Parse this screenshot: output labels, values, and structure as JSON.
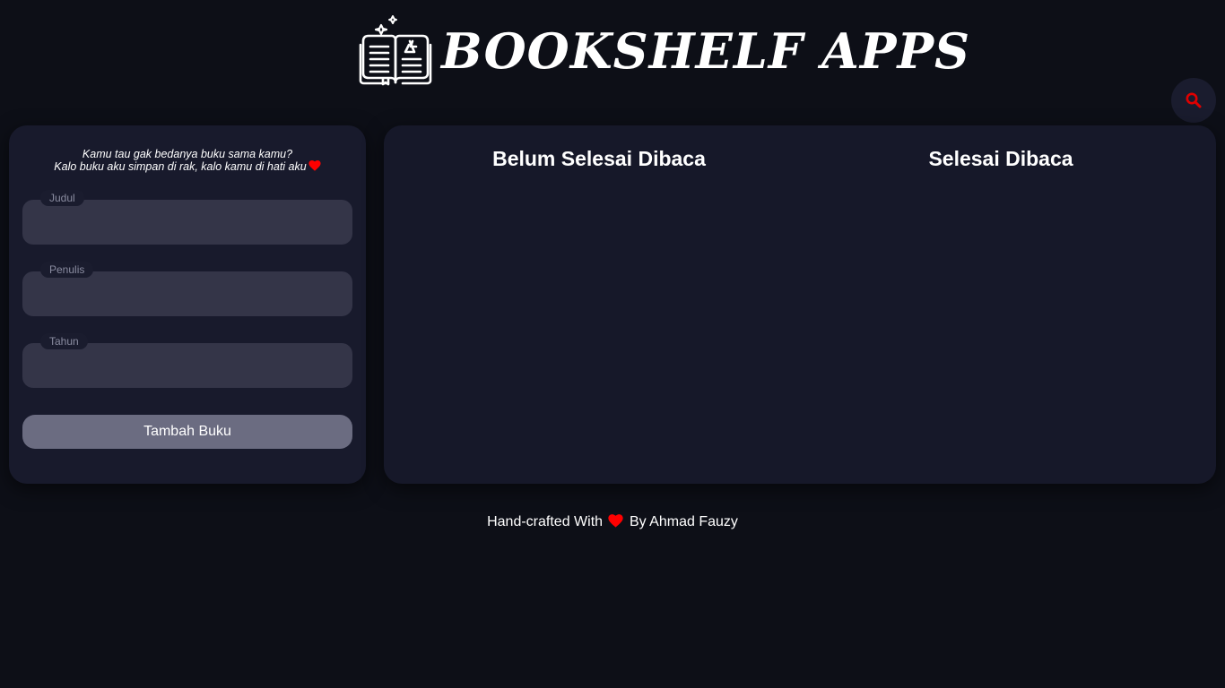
{
  "header": {
    "title": "BOOKSHELF APPS",
    "logo_icon": "open-book-sparkle-icon"
  },
  "search": {
    "icon": "search-icon",
    "icon_color": "#e00000"
  },
  "form": {
    "quote_line1": "Kamu tau gak bedanya buku sama kamu?",
    "quote_line2": "Kalo buku aku simpan di rak, kalo kamu di hati aku",
    "heart_color": "#ff0000",
    "fields": [
      {
        "label": "Judul",
        "value": "",
        "placeholder": ""
      },
      {
        "label": "Penulis",
        "value": "",
        "placeholder": ""
      },
      {
        "label": "Tahun",
        "value": "",
        "placeholder": ""
      }
    ],
    "submit_label": "Tambah Buku"
  },
  "shelves": {
    "unread_title": "Belum Selesai Dibaca",
    "read_title": "Selesai Dibaca",
    "unread_books": [],
    "read_books": []
  },
  "footer": {
    "prefix": "Hand-crafted With",
    "suffix": "By Ahmad Fauzy"
  },
  "colors": {
    "background": "#0d0f17",
    "card": "#181a2c",
    "input": "#343548",
    "button": "#6b6c81",
    "heart": "#ff0000"
  }
}
